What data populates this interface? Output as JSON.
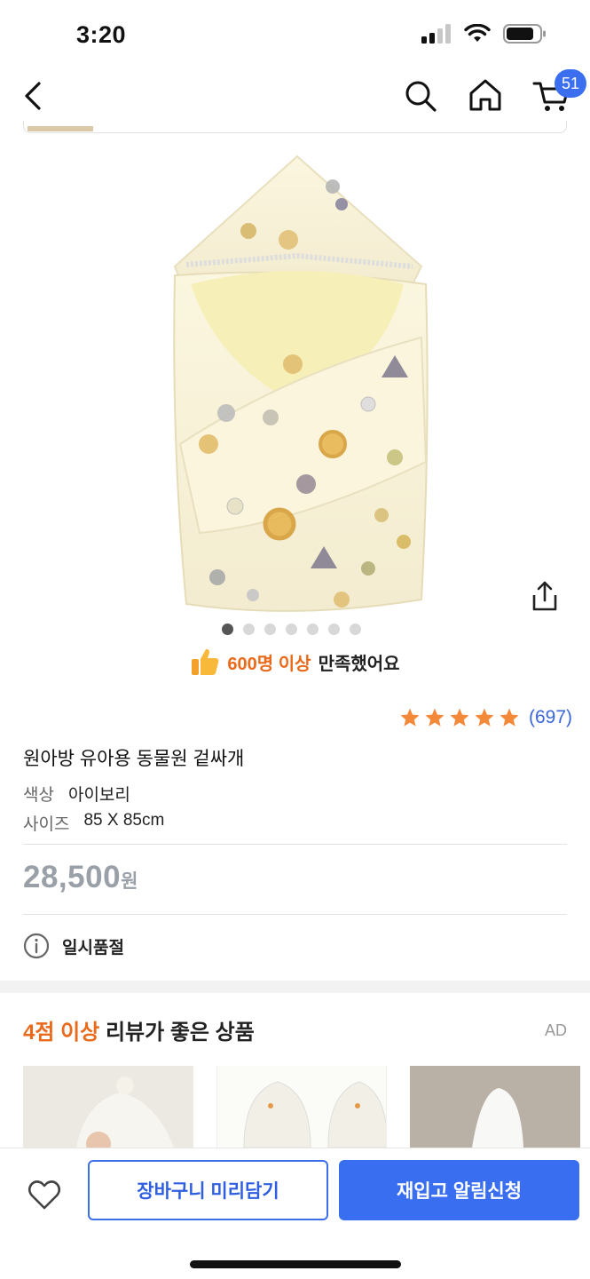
{
  "status_bar": {
    "time": "3:20"
  },
  "nav": {
    "cart_count": "51"
  },
  "gallery": {
    "dot_count": 7,
    "active_index": 0
  },
  "satisfaction": {
    "highlight": "600명 이상",
    "rest": "만족했어요"
  },
  "rating": {
    "stars": 5,
    "count": "(697)"
  },
  "product": {
    "title": "원아방 유아용 동물원 겉싸개",
    "options": [
      {
        "label": "색상",
        "value": "아이보리"
      },
      {
        "label": "사이즈",
        "value": "85 X 85cm"
      }
    ],
    "price_number": "28,500",
    "price_unit": "원",
    "status": "일시품절"
  },
  "recommend": {
    "highlight": "4점 이상",
    "rest": "리뷰가 좋은 상품",
    "ad_label": "AD"
  },
  "bottom_bar": {
    "preorder_label": "장바구니 미리담기",
    "restock_label": "재입고 알림신청"
  },
  "colors": {
    "accent_blue": "#3a6ef0",
    "highlight_orange": "#e86a1a",
    "star": "#f5893a"
  }
}
